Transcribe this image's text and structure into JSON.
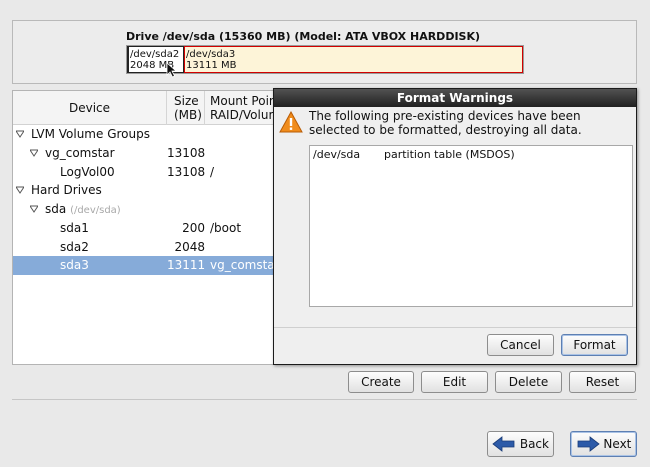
{
  "drive": {
    "title": "Drive /dev/sda (15360 MB) (Model: ATA VBOX HARDDISK)",
    "partitions": [
      {
        "name": "/dev/sda2",
        "size": "2048 MB"
      },
      {
        "name": "/dev/sda3",
        "size": "13111 MB"
      }
    ]
  },
  "tree": {
    "headers": {
      "device": "Device",
      "size": "Size\n(MB)",
      "mount": "Mount Point/\nRAID/Volume"
    },
    "rows": [
      {
        "device": "LVM Volume Groups",
        "size": "",
        "mount": ""
      },
      {
        "device": "vg_comstar",
        "size": "13108",
        "mount": ""
      },
      {
        "device": "LogVol00",
        "size": "13108",
        "mount": "/"
      },
      {
        "device": "Hard Drives",
        "size": "",
        "mount": ""
      },
      {
        "device": "sda",
        "path": "(/dev/sda)",
        "size": "",
        "mount": ""
      },
      {
        "device": "sda1",
        "size": "200",
        "mount": "/boot"
      },
      {
        "device": "sda2",
        "size": "2048",
        "mount": ""
      },
      {
        "device": "sda3",
        "size": "13111",
        "mount": "vg_comstar"
      }
    ]
  },
  "dialog": {
    "title": "Format Warnings",
    "message": "The following pre-existing devices have been selected to be formatted, destroying all data.",
    "devices": [
      {
        "name": "/dev/sda",
        "description": "partition table (MSDOS)"
      }
    ],
    "cancel_label": "Cancel",
    "format_label": "Format"
  },
  "actions": {
    "create": "Create",
    "edit": "Edit",
    "delete": "Delete",
    "reset": "Reset"
  },
  "nav": {
    "back": "Back",
    "next": "Next"
  },
  "colors": {
    "selection": "#86abd9",
    "sda3_fill": "#fdf4d8",
    "sda3_border": "#d10000",
    "arrow": "#2c5aa8"
  }
}
